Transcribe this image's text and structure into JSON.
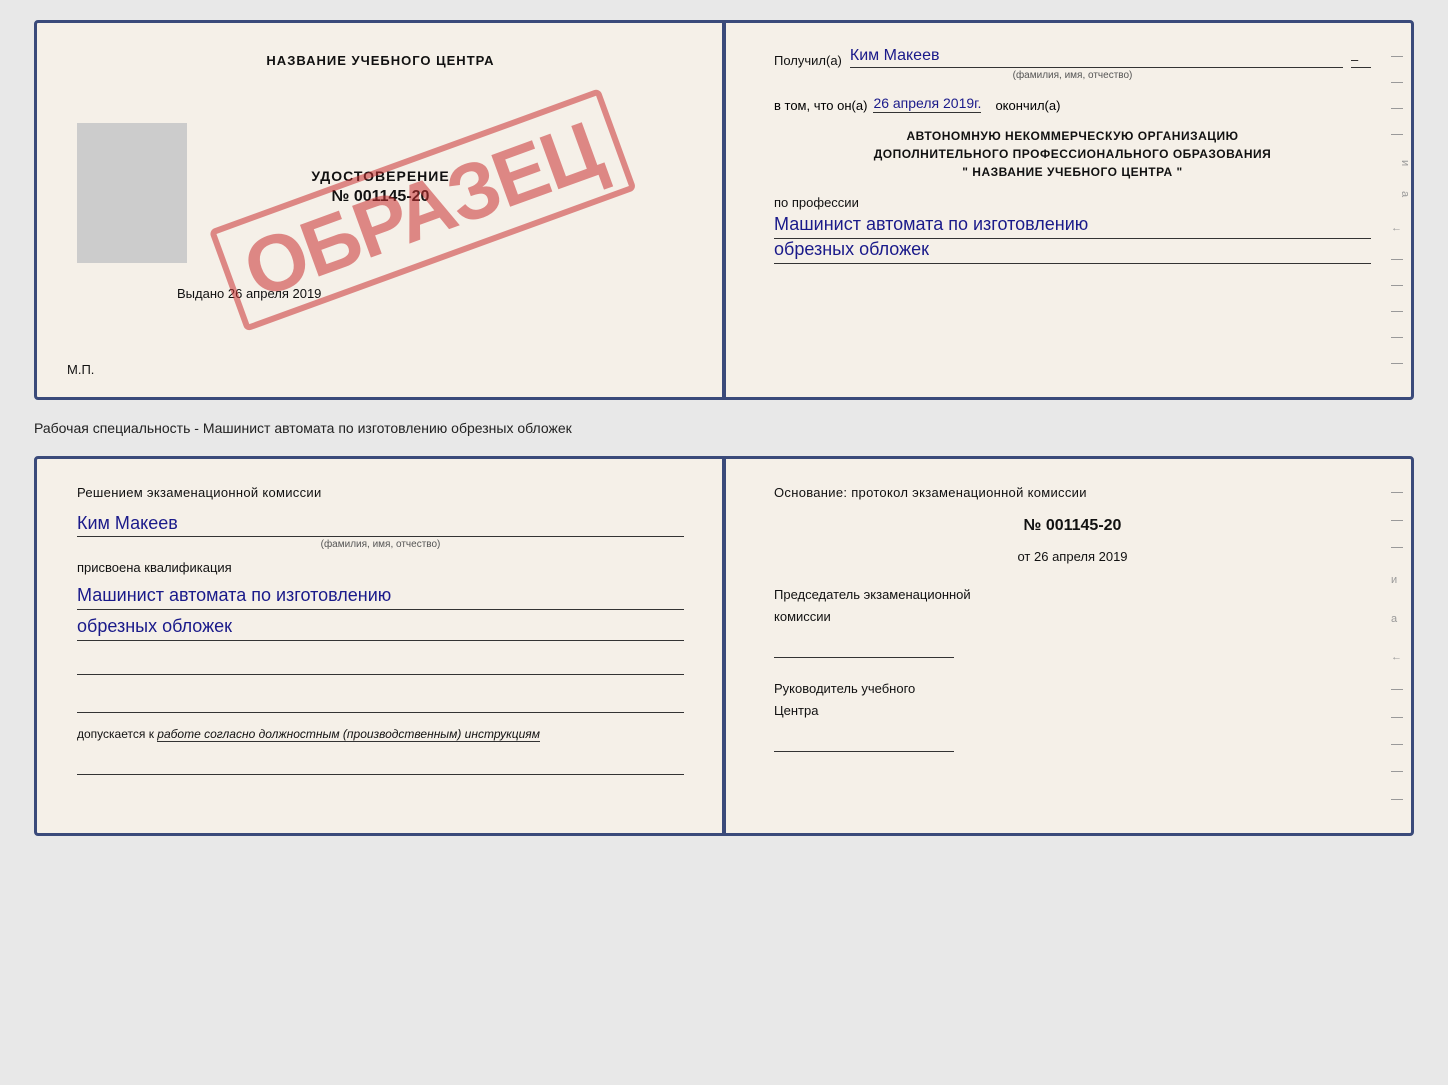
{
  "topDoc": {
    "left": {
      "header": "НАЗВАНИЕ УЧЕБНОГО ЦЕНТРА",
      "certTitle": "УДОСТОВЕРЕНИЕ",
      "certNumber": "№ 001145-20",
      "issueDateLabel": "Выдано",
      "issueDate": "26 апреля 2019",
      "mpLabel": "М.П.",
      "stamp": "ОБРАЗЕЦ"
    },
    "right": {
      "receivedLabel": "Получил(а)",
      "receivedName": "Ким Макеев",
      "receivedSub": "(фамилия, имя, отчество)",
      "inThatLabel": "в том, что он(а)",
      "date": "26 апреля 2019г.",
      "finishedLabel": "окончил(а)",
      "orgLine1": "АВТОНОМНУЮ НЕКОММЕРЧЕСКУЮ ОРГАНИЗАЦИЮ",
      "orgLine2": "ДОПОЛНИТЕЛЬНОГО ПРОФЕССИОНАЛЬНОГО ОБРАЗОВАНИЯ",
      "orgLine3": "\"  НАЗВАНИЕ УЧЕБНОГО ЦЕНТРА  \"",
      "professionLabel": "по профессии",
      "profession1": "Машинист автомата по изготовлению",
      "profession2": "обрезных обложек"
    }
  },
  "caption": "Рабочая специальность - Машинист автомата по изготовлению обрезных обложек",
  "bottomDoc": {
    "left": {
      "decisionText": "Решением экзаменационной комиссии",
      "name": "Ким Макеев",
      "nameSub": "(фамилия, имя, отчество)",
      "assignedText": "присвоена квалификация",
      "qual1": "Машинист автомата по изготовлению",
      "qual2": "обрезных обложек",
      "допускаетсяLabel": "допускается к",
      "допускаетсяText": "работе согласно должностным (производственным) инструкциям"
    },
    "right": {
      "basisText": "Основание: протокол экзаменационной комиссии",
      "protocolNumber": "№ 001145-20",
      "fromLabel": "от",
      "fromDate": "26 апреля 2019",
      "chairmanLabel1": "Председатель экзаменационной",
      "chairmanLabel2": "комиссии",
      "headLabel1": "Руководитель учебного",
      "headLabel2": "Центра"
    }
  }
}
